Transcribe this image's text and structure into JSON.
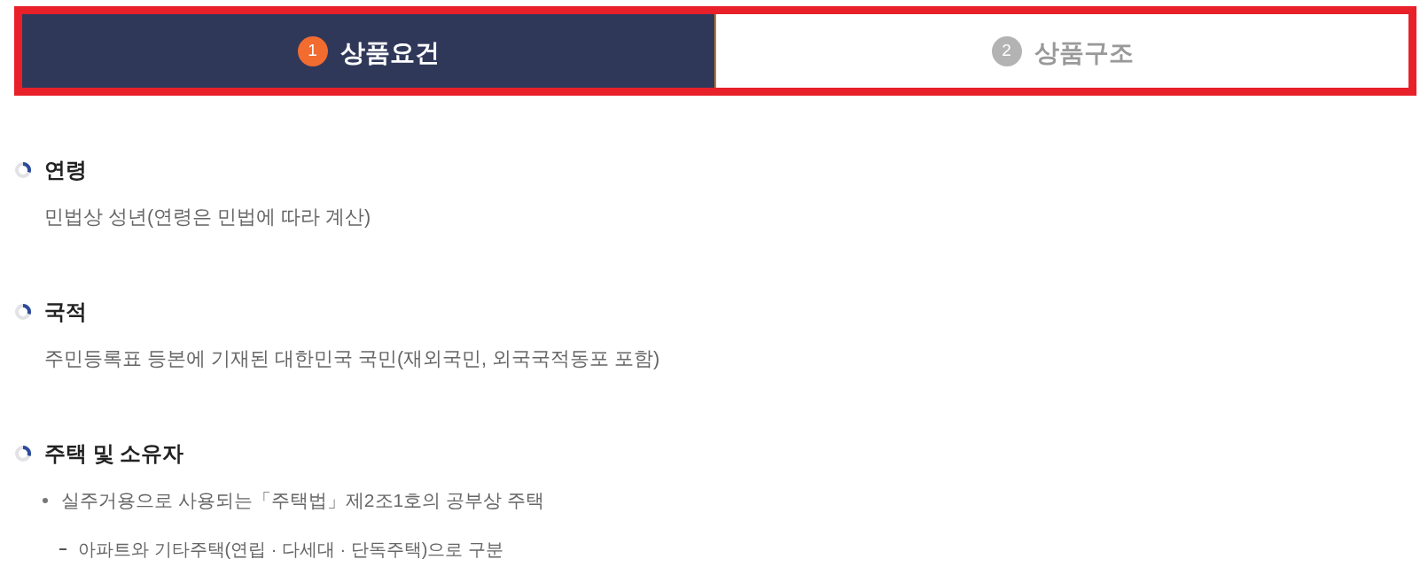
{
  "tabs": [
    {
      "number": "1",
      "label": "상품요건",
      "selected": true
    },
    {
      "number": "2",
      "label": "상품구조",
      "selected": false
    }
  ],
  "sections": [
    {
      "title": "연령",
      "items": [
        {
          "kind": "text",
          "text": "민법상 성년(연령은 민법에 따라 계산)"
        }
      ]
    },
    {
      "title": "국적",
      "items": [
        {
          "kind": "text",
          "text": "주민등록표 등본에 기재된 대한민국 국민(재외국민, 외국국적동포 포함)"
        }
      ]
    },
    {
      "title": "주택 및 소유자",
      "items": [
        {
          "kind": "bullet",
          "text": "실주거용으로 사용되는「주택법」제2조1호의 공부상 주택",
          "children": [
            {
              "kind": "dash",
              "text": "아파트와 기타주택(연립 · 다세대 · 단독주택)으로 구분"
            }
          ]
        }
      ]
    }
  ]
}
